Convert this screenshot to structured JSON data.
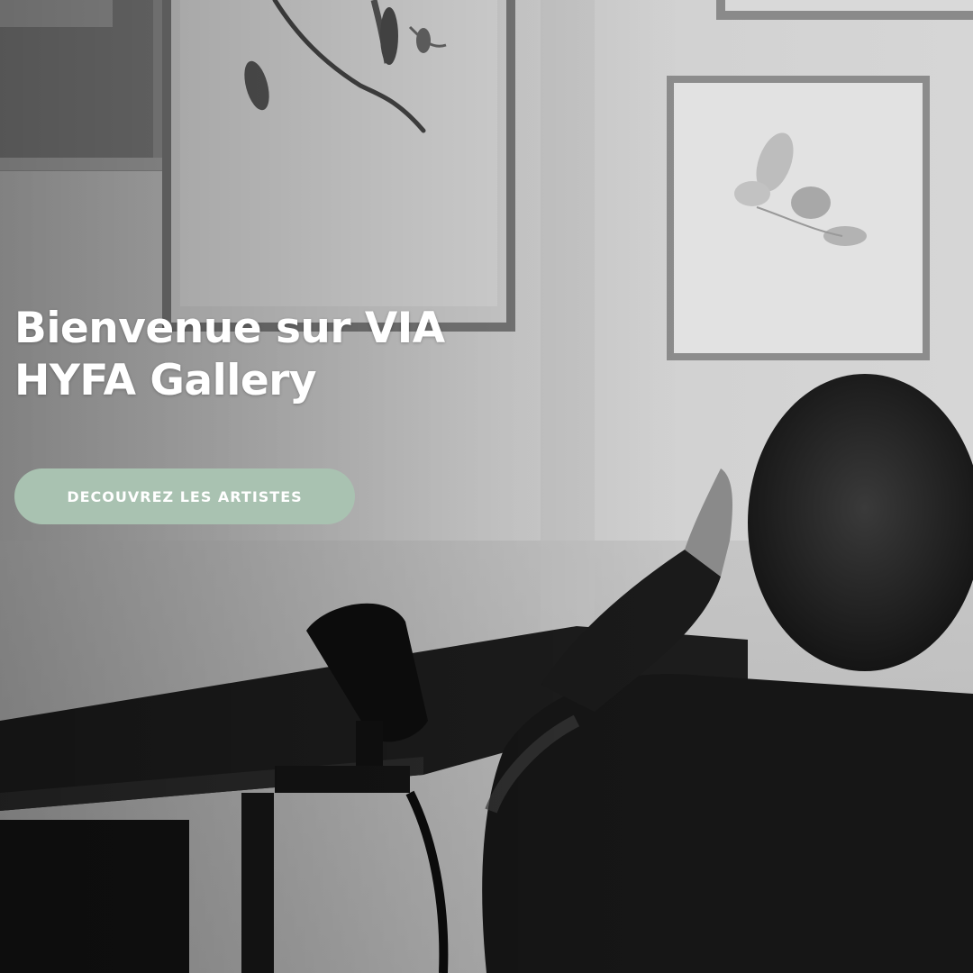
{
  "hero": {
    "title": "Bienvenue sur VIA HYFA Gallery",
    "cta_label": "DECOUVREZ LES ARTISTES",
    "photo_alt": "Photo en noir et blanc d'un enfant regardant des œuvres encadrées dans une galerie",
    "photo_style": "grayscale",
    "colors": {
      "cta_background": "#a9c2b1",
      "cta_text": "#ffffff",
      "title_text": "#ffffff"
    }
  }
}
